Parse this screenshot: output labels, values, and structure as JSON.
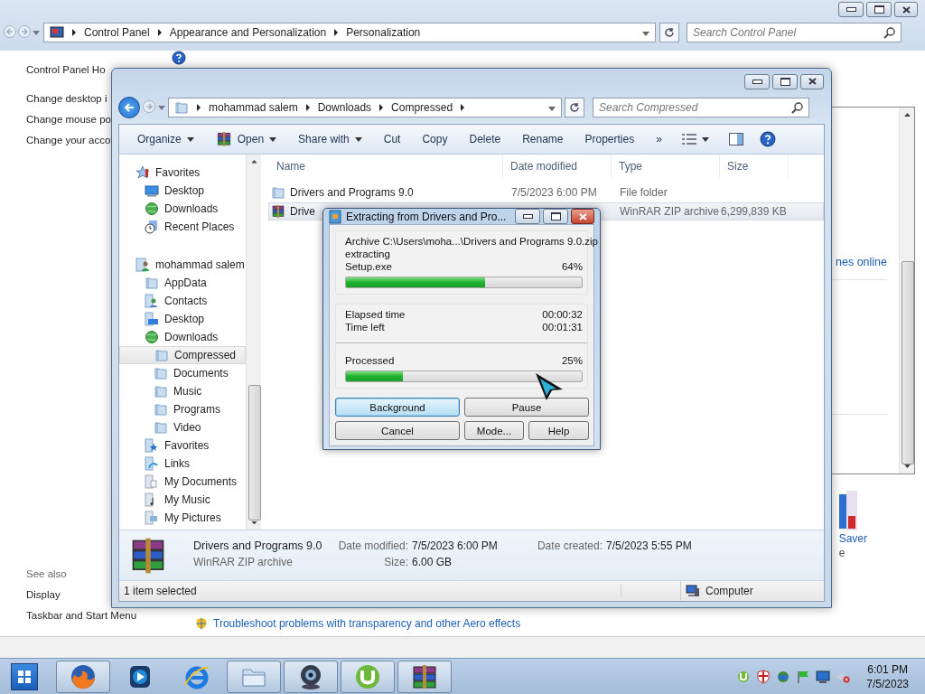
{
  "control_panel": {
    "breadcrumb": [
      "Control Panel",
      "Appearance and Personalization",
      "Personalization"
    ],
    "search": {
      "placeholder": "Search Control Panel"
    },
    "home_link": "Control Panel Ho",
    "task_links": [
      "Change desktop i",
      "Change mouse po",
      "Change your acco"
    ],
    "content_link": "nes online",
    "saver_label": "Saver",
    "saver_caption": "e",
    "see_also_label": "See also",
    "see_also_links": [
      "Display",
      "Taskbar and Start Menu"
    ],
    "aero_link": "Troubleshoot problems with transparency and other Aero effects"
  },
  "explorer": {
    "breadcrumb": [
      "mohammad salem",
      "Downloads",
      "Compressed"
    ],
    "search": {
      "placeholder": "Search Compressed"
    },
    "toolbar": [
      {
        "kind": "menu",
        "label": "Organize"
      },
      {
        "kind": "open",
        "label": "Open"
      },
      {
        "kind": "menu",
        "label": "Share with"
      },
      {
        "kind": "plain",
        "label": "Cut"
      },
      {
        "kind": "plain",
        "label": "Copy"
      },
      {
        "kind": "plain",
        "label": "Delete"
      },
      {
        "kind": "plain",
        "label": "Rename"
      },
      {
        "kind": "plain",
        "label": "Properties"
      },
      {
        "kind": "plain",
        "label": "»"
      }
    ],
    "nav": [
      {
        "label": "Favorites",
        "kind": "star",
        "selected": false,
        "children": [
          {
            "label": "Desktop",
            "kind": "monitor",
            "selected": false
          },
          {
            "label": "Downloads",
            "kind": "globe",
            "selected": false
          },
          {
            "label": "Recent Places",
            "kind": "recent",
            "selected": false
          }
        ]
      },
      {
        "label": "mohammad salem",
        "kind": "user",
        "selected": false,
        "children": [
          {
            "label": "AppData",
            "kind": "folder",
            "selected": false
          },
          {
            "label": "Contacts",
            "kind": "contacts",
            "selected": false
          },
          {
            "label": "Desktop",
            "kind": "desk",
            "selected": false
          },
          {
            "label": "Downloads",
            "kind": "globe",
            "selected": false,
            "children": [
              {
                "label": "Compressed",
                "kind": "folder",
                "selected": true
              },
              {
                "label": "Documents",
                "kind": "folder",
                "selected": false
              },
              {
                "label": "Music",
                "kind": "folder",
                "selected": false
              },
              {
                "label": "Programs",
                "kind": "folder",
                "selected": false
              },
              {
                "label": "Video",
                "kind": "folder",
                "selected": false
              }
            ]
          },
          {
            "label": "Favorites",
            "kind": "starfolder",
            "selected": false
          },
          {
            "label": "Links",
            "kind": "links",
            "selected": false
          },
          {
            "label": "My Documents",
            "kind": "docs",
            "selected": false
          },
          {
            "label": "My Music",
            "kind": "music",
            "selected": false
          },
          {
            "label": "My Pictures",
            "kind": "pictures",
            "selected": false
          }
        ]
      }
    ],
    "columns": [
      "Name",
      "Date modified",
      "Type",
      "Size"
    ],
    "files": [
      {
        "kind": "folder",
        "name": "Drivers and Programs 9.0",
        "date": "7/5/2023 6:00 PM",
        "type": "File folder",
        "selected": false
      },
      {
        "kind": "archive",
        "name": "Drive",
        "type": "WinRAR ZIP archive",
        "size": "6,299,839 KB",
        "selected": true
      }
    ],
    "details": {
      "name": "Drivers and Programs 9.0",
      "type": "WinRAR ZIP archive",
      "fields": [
        {
          "label": "Date modified:",
          "value": "7/5/2023 6:00 PM"
        },
        {
          "label": "Size:",
          "value": "6.00 GB"
        },
        {
          "label": "Date created:",
          "value": "7/5/2023 5:55 PM"
        }
      ]
    },
    "status": "1 item selected",
    "location": "Computer"
  },
  "dialog": {
    "title": "Extracting from Drivers and Pro...",
    "archive": "Archive C:\\Users\\moha...\\Drivers and Programs 9.0.zip",
    "action": "extracting",
    "current_file": "Setup.exe",
    "file_percent": "64%",
    "file_progress": {
      "level": 0.59
    },
    "times": [
      {
        "label": "Elapsed time",
        "value": "00:00:32"
      },
      {
        "label": "Time left",
        "value": "00:01:31"
      }
    ],
    "processed_label": "Processed",
    "processed_percent": "25%",
    "processed_progress": {
      "level": 0.24
    },
    "buttons": [
      {
        "label": "Background",
        "default": true
      },
      {
        "label": "Pause",
        "default": false
      },
      {
        "label": "Cancel",
        "default": false
      },
      {
        "label": "Mode...",
        "default": false
      },
      {
        "label": "Help",
        "default": false
      }
    ]
  },
  "taskbar": {
    "apps": [
      {
        "kind": "firefox",
        "running": true
      },
      {
        "kind": "media",
        "running": false
      },
      {
        "kind": "ie",
        "running": false
      },
      {
        "kind": "folder",
        "running": true
      },
      {
        "kind": "webcam",
        "running": true
      },
      {
        "kind": "utorrent",
        "running": true
      },
      {
        "kind": "winrar",
        "running": true
      }
    ],
    "time": "6:01 PM",
    "date": "7/5/2023"
  }
}
